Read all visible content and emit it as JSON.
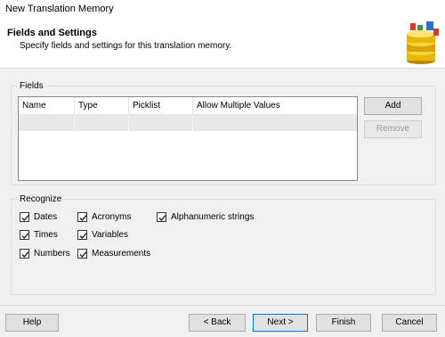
{
  "window": {
    "title": "New Translation Memory"
  },
  "header": {
    "title": "Fields and Settings",
    "subtitle": "Specify fields and settings for this translation memory."
  },
  "fields": {
    "group_label": "Fields",
    "columns": [
      "Name",
      "Type",
      "Picklist",
      "Allow Multiple Values"
    ],
    "add_label": "Add",
    "remove_label": "Remove"
  },
  "recognize": {
    "group_label": "Recognize",
    "options": [
      {
        "label": "Dates",
        "checked": true
      },
      {
        "label": "Times",
        "checked": true
      },
      {
        "label": "Numbers",
        "checked": true
      },
      {
        "label": "Acronyms",
        "checked": true
      },
      {
        "label": "Variables",
        "checked": true
      },
      {
        "label": "Measurements",
        "checked": true
      },
      {
        "label": "Alphanumeric strings",
        "checked": true
      }
    ]
  },
  "footer": {
    "help": "Help",
    "back": "< Back",
    "next": "Next >",
    "finish": "Finish",
    "cancel": "Cancel"
  },
  "icons": {
    "header_icon": "database-gold-icon",
    "checkbox_mark": "checkmark-icon"
  }
}
